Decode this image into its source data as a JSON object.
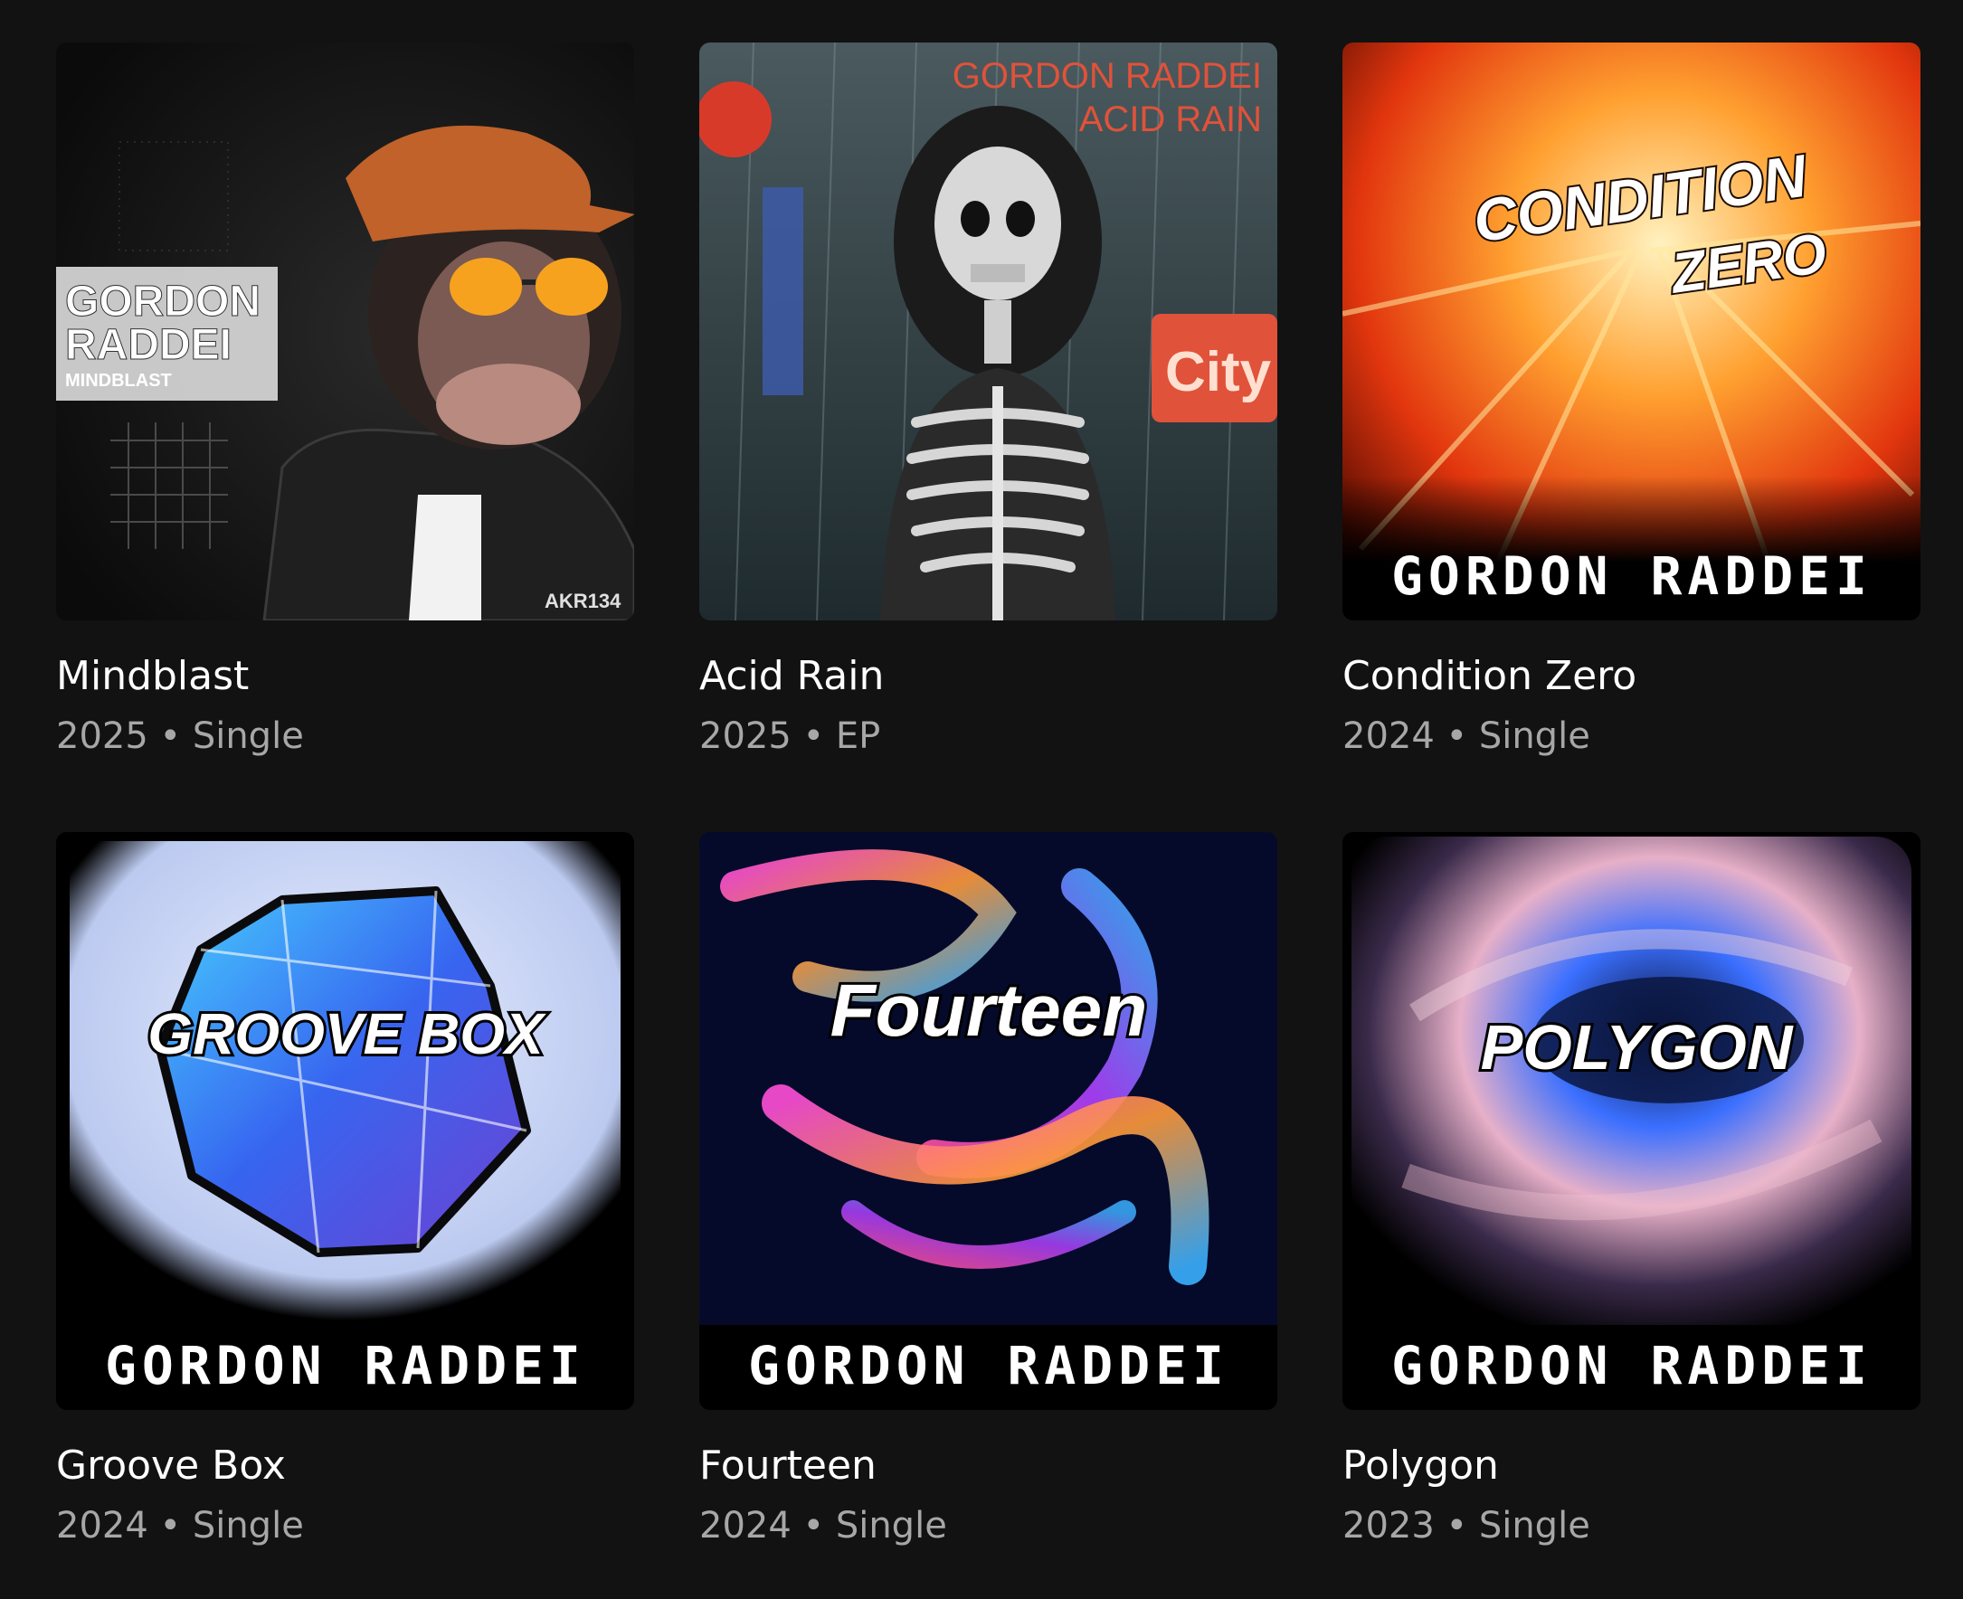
{
  "releases": [
    {
      "title": "Mindblast",
      "year": "2025",
      "separator": "•",
      "type": "Single",
      "cover": {
        "artist_line1": "GORDON",
        "artist_line2": "RADDEI",
        "subtitle": "MINDBLAST",
        "catalog": "AKR134",
        "colors": {
          "bg": "#0d0d0d",
          "cap": "#c0622a",
          "glasses": "#f7a21f"
        }
      }
    },
    {
      "title": "Acid Rain",
      "year": "2025",
      "separator": "•",
      "type": "EP",
      "cover": {
        "artist": "GORDON RADDEI",
        "subtitle": "ACID RAIN",
        "sign_text": "City",
        "colors": {
          "text": "#e0523a",
          "bg": "#2a3a40"
        }
      }
    },
    {
      "title": "Condition Zero",
      "year": "2024",
      "separator": "•",
      "type": "Single",
      "cover": {
        "line1": "CONDITION",
        "line2": "ZERO",
        "artist": "GORDON RADDEI",
        "colors": {
          "hot": "#ff5a10",
          "glow": "#ffd060"
        }
      }
    },
    {
      "title": "Groove Box",
      "year": "2024",
      "separator": "•",
      "type": "Single",
      "cover": {
        "label": "GROOVE BOX",
        "artist": "GORDON RADDEI",
        "colors": {
          "bg": "#c9d6f6",
          "gem": "#2f6df0"
        }
      }
    },
    {
      "title": "Fourteen",
      "year": "2024",
      "separator": "•",
      "type": "Single",
      "cover": {
        "label": "Fourteen",
        "artist": "GORDON RADDEI",
        "colors": {
          "bg": "#060a2a",
          "swirl1": "#ff4fd8",
          "swirl2": "#3ab0ff"
        }
      }
    },
    {
      "title": "Polygon",
      "year": "2023",
      "separator": "•",
      "type": "Single",
      "cover": {
        "label": "POLYGON",
        "artist": "GORDON RADDEI",
        "colors": {
          "bg": "#1b1f3a",
          "swirl": "#3a6fff",
          "pink": "#e7b0c8"
        }
      }
    }
  ]
}
